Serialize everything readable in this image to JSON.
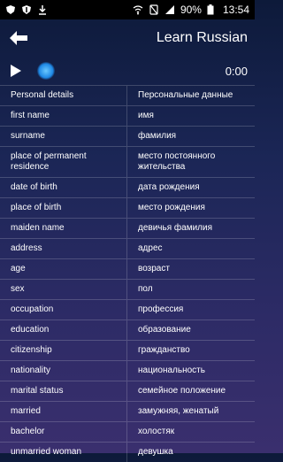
{
  "status_bar": {
    "battery": "90%",
    "time": "13:54",
    "icons": [
      "shield-icon",
      "shield-icon",
      "download-icon",
      "wifi-icon",
      "no-sim-icon",
      "signal-icon",
      "battery-icon"
    ]
  },
  "header": {
    "title": "Learn Russian",
    "back_icon": "back-arrow-icon"
  },
  "player": {
    "time": "0:00",
    "progress": 0.0
  },
  "table": {
    "columns": [
      "Personal details",
      "Персональные данные"
    ],
    "rows": [
      {
        "en": "first name",
        "ru": "имя"
      },
      {
        "en": "surname",
        "ru": "фамилия"
      },
      {
        "en": "place of permanent residence",
        "ru": "место постоянного жительства"
      },
      {
        "en": "date of birth",
        "ru": "дата рождения"
      },
      {
        "en": "place of birth",
        "ru": "место рождения"
      },
      {
        "en": "maiden name",
        "ru": "девичья фамилия"
      },
      {
        "en": "address",
        "ru": "адрес"
      },
      {
        "en": "age",
        "ru": "возраст"
      },
      {
        "en": "sex",
        "ru": "пол"
      },
      {
        "en": "occupation",
        "ru": "профессия"
      },
      {
        "en": "education",
        "ru": "образование"
      },
      {
        "en": "citizenship",
        "ru": "гражданство"
      },
      {
        "en": "nationality",
        "ru": "национальность"
      },
      {
        "en": "marital status",
        "ru": "семейное положение"
      },
      {
        "en": "married",
        "ru": "замужняя, женатый"
      },
      {
        "en": "bachelor",
        "ru": "холостяк"
      },
      {
        "en": "unmarried woman",
        "ru": "девушка"
      }
    ]
  }
}
